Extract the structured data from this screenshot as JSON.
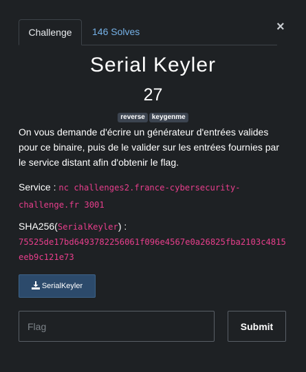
{
  "tabs": {
    "challenge": "Challenge",
    "solves": "146 Solves"
  },
  "close_glyph": "×",
  "challenge": {
    "name": "Serial Keyler",
    "value": "27",
    "tags": [
      "reverse",
      "keygenme"
    ],
    "description": "On vous demande d'écrire un générateur d'entrées valides pour ce binaire, puis de le valider sur les entrées fournies par le service distant afin d'obtenir le flag.",
    "service_label": "Service : ",
    "service_command": "nc challenges2.france-cybersecurity-challenge.fr 3001",
    "sha_prefix": "SHA256(",
    "sha_file": "SerialKeyler",
    "sha_suffix": ") :",
    "sha_hash": "75525de17bd6493782256061f096e4567e0a26825fba2103c4815eeb9c121e73"
  },
  "download": {
    "label": "SerialKeyler",
    "icon": "download-icon"
  },
  "flag_input": {
    "placeholder": "Flag",
    "value": ""
  },
  "submit_label": "Submit"
}
